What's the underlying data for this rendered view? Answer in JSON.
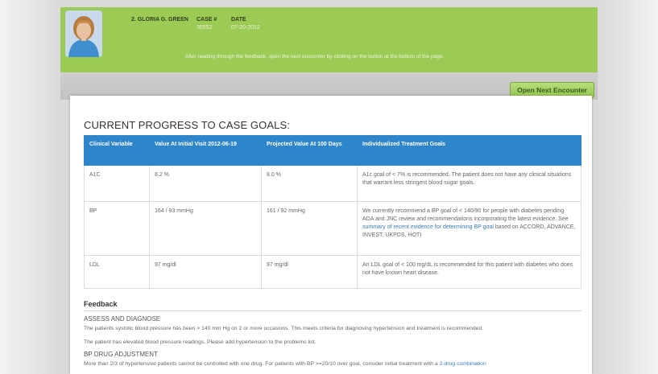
{
  "header": {
    "patient_name": "2. GLORIA G. GREEN",
    "case_label": "CASE #",
    "case_value": "35552",
    "date_label": "DATE",
    "date_value": "07-20-2012",
    "instruction": "After reading through the feedback, open the next encounter by clicking on the button at the bottom of the page."
  },
  "toolbar": {
    "open_next_label": "Open Next Encounter"
  },
  "progress": {
    "title": "CURRENT PROGRESS TO CASE GOALS:",
    "columns": [
      "Clinical Variable",
      "Value At Initial Visit 2012-06-19",
      "Projected Value At 100 Days",
      "Individualized Treatment Goals"
    ],
    "rows": [
      {
        "variable": "A1C",
        "initial": "8.2 %",
        "projected": "8.0 %",
        "goal": "A1c goal of < 7% is recommended. The patient does not have any clinical situations that warrant less stringent blood sugar goals."
      },
      {
        "variable": "BP",
        "initial": "164 / 93 mmHg",
        "projected": "161 / 92 mmHg",
        "goal_pre": "We currently recommend a BP goal of < 140/90 for people with diabetes pending ADA and JNC review and recommendations incorporating the latest evidence. See ",
        "goal_link": "summary of recent evidence for determining BP goal",
        "goal_post": " based on ACCORD, ADVANCE, INVEST, UKPDS, HOT)"
      },
      {
        "variable": "LDL",
        "initial": "97 mg/dl",
        "projected": "97 mg/dl",
        "goal": "An LDL goal of < 100 mg/dL is recommended for this patient with diabetes who does not have known heart disease."
      }
    ]
  },
  "feedback": {
    "title": "Feedback",
    "assess_heading": "ASSESS AND DIAGNOSE",
    "assess_text_1": "The patients systolic blood pressure has been > 140 mm Hg on 2 or more occasions. This meets criteria for diagnosing hypertension and treatment is recommended.",
    "assess_text_2": "The patient has elevated blood pressure readings. Please add hypertension to the problems list.",
    "bp_heading": "BP DRUG ADJUSTMENT",
    "bp_text_pre": "More than 2/3 of hypertensive patients cannot be controlled with one drug. For patients with BP >=20/10 over goal, consider initial treatment with a ",
    "bp_text_link": "2-drug combination"
  }
}
